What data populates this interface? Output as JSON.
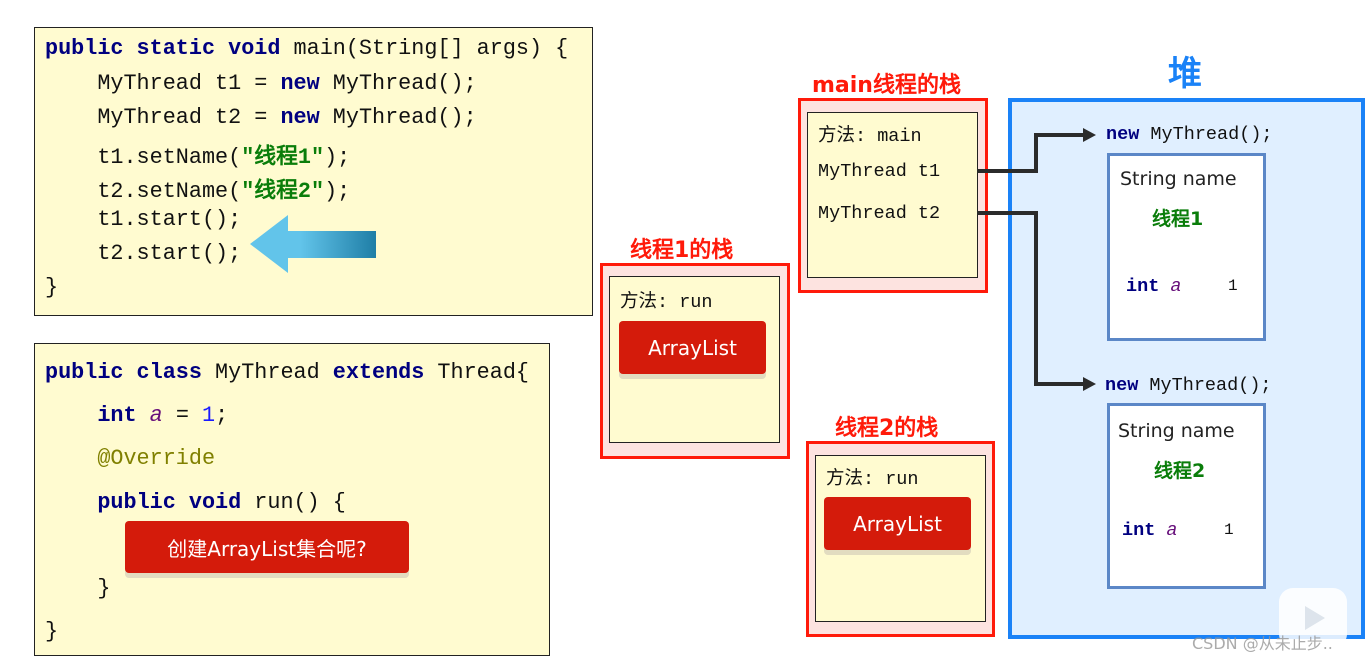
{
  "main_code": [
    [
      [
        "public static void ",
        "kw"
      ],
      [
        "main(String[] args) {",
        ""
      ]
    ],
    [
      [
        "    MyThread t1 = ",
        ""
      ],
      [
        "new",
        "kw"
      ],
      [
        " MyThread();",
        ""
      ]
    ],
    [
      [
        "    MyThread t2 = ",
        ""
      ],
      [
        "new",
        "kw"
      ],
      [
        " MyThread();",
        ""
      ]
    ],
    [
      [
        "    t1.setName(",
        ""
      ],
      [
        "\"线程1\"",
        "str"
      ],
      [
        ");",
        ""
      ]
    ],
    [
      [
        "    t2.setName(",
        ""
      ],
      [
        "\"线程2\"",
        "str"
      ],
      [
        ");",
        ""
      ]
    ],
    [
      [
        "    t1.start();",
        ""
      ]
    ],
    [
      [
        "    t2.start();",
        ""
      ]
    ],
    [
      [
        "}",
        ""
      ]
    ]
  ],
  "class_code": [
    [
      [
        "public class ",
        "kw"
      ],
      [
        "MyThread ",
        ""
      ],
      [
        "extends",
        "kw"
      ],
      [
        " Thread{",
        ""
      ]
    ],
    [
      [
        "    ",
        ""
      ],
      [
        "int",
        "kw"
      ],
      [
        " ",
        ""
      ],
      [
        "a",
        "var"
      ],
      [
        " = ",
        ""
      ],
      [
        "1",
        "num"
      ],
      [
        ";",
        ""
      ]
    ],
    [
      [
        "    @Override",
        "ann"
      ]
    ],
    [
      [
        "    ",
        ""
      ],
      [
        "public void",
        "kw"
      ],
      [
        " run() {",
        ""
      ]
    ],
    [
      [
        "    }",
        ""
      ]
    ],
    [
      [
        "}",
        ""
      ]
    ]
  ],
  "callout": "创建ArrayList集合呢?",
  "thread1_stack": {
    "title": "线程1的栈",
    "method": "方法: run",
    "button": "ArrayList"
  },
  "thread2_stack": {
    "title": "线程2的栈",
    "method": "方法: run",
    "button": "ArrayList"
  },
  "main_stack": {
    "title": "main线程的栈",
    "method": "方法: main",
    "var1": "MyThread t1",
    "var2": "MyThread t2"
  },
  "heap": {
    "title": "堆",
    "objects": [
      {
        "new_kw": "new",
        "ctor": " MyThread();",
        "field": "String name",
        "name_value": "线程1",
        "int_kw": "int",
        "var": "a",
        "value": "1"
      },
      {
        "new_kw": "new",
        "ctor": " MyThread();",
        "field": "String name",
        "name_value": "线程2",
        "int_kw": "int",
        "var": "a",
        "value": "1"
      }
    ]
  },
  "watermark": "CSDN @从未止步..",
  "colors": {
    "stack_border": "#ff1a0a",
    "heap_border": "#1a82f7",
    "heap_bg": "#e0efff",
    "code_bg": "#fffbd0",
    "button": "#d41b0b"
  }
}
